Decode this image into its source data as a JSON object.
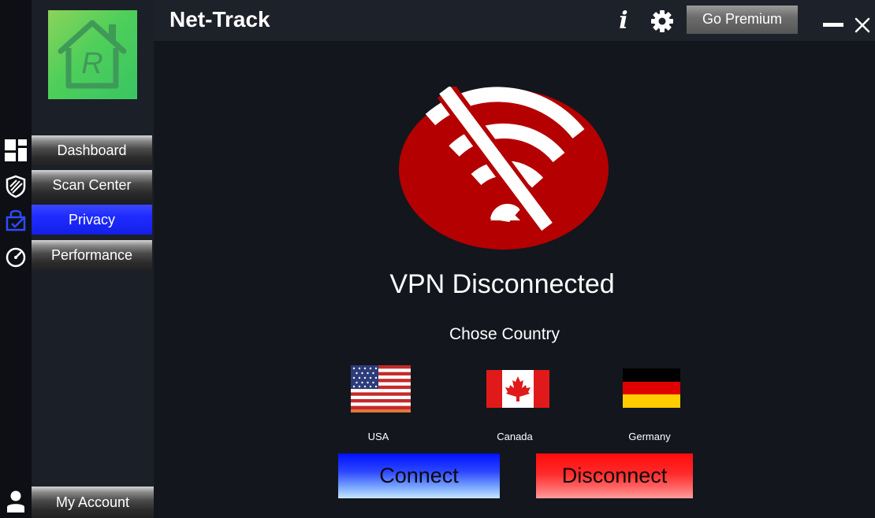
{
  "app": {
    "title": "Net-Track"
  },
  "logo": {
    "letter": "R"
  },
  "header": {
    "info_glyph": "i",
    "premium_label": "Go Premium"
  },
  "nav": {
    "items": [
      {
        "label": "Dashboard",
        "icon": "dashboard-icon",
        "active": false
      },
      {
        "label": "Scan Center",
        "icon": "shield-icon",
        "active": false
      },
      {
        "label": "Privacy",
        "icon": "privacy-lock-icon",
        "active": true
      },
      {
        "label": "Performance",
        "icon": "speedometer-icon",
        "active": false
      }
    ],
    "account_label": "My Account"
  },
  "vpn": {
    "status": "VPN Disconnected",
    "choose_label": "Chose Country",
    "countries": [
      {
        "name": "USA",
        "flag": "usa-flag-icon"
      },
      {
        "name": "Canada",
        "flag": "canada-flag-icon"
      },
      {
        "name": "Germany",
        "flag": "germany-flag-icon"
      }
    ],
    "connect_label": "Connect",
    "disconnect_label": "Disconnect"
  },
  "colors": {
    "accent_blue": "#1e2bff",
    "danger_red": "#b30000",
    "logo_green": "#4fcf5a"
  }
}
